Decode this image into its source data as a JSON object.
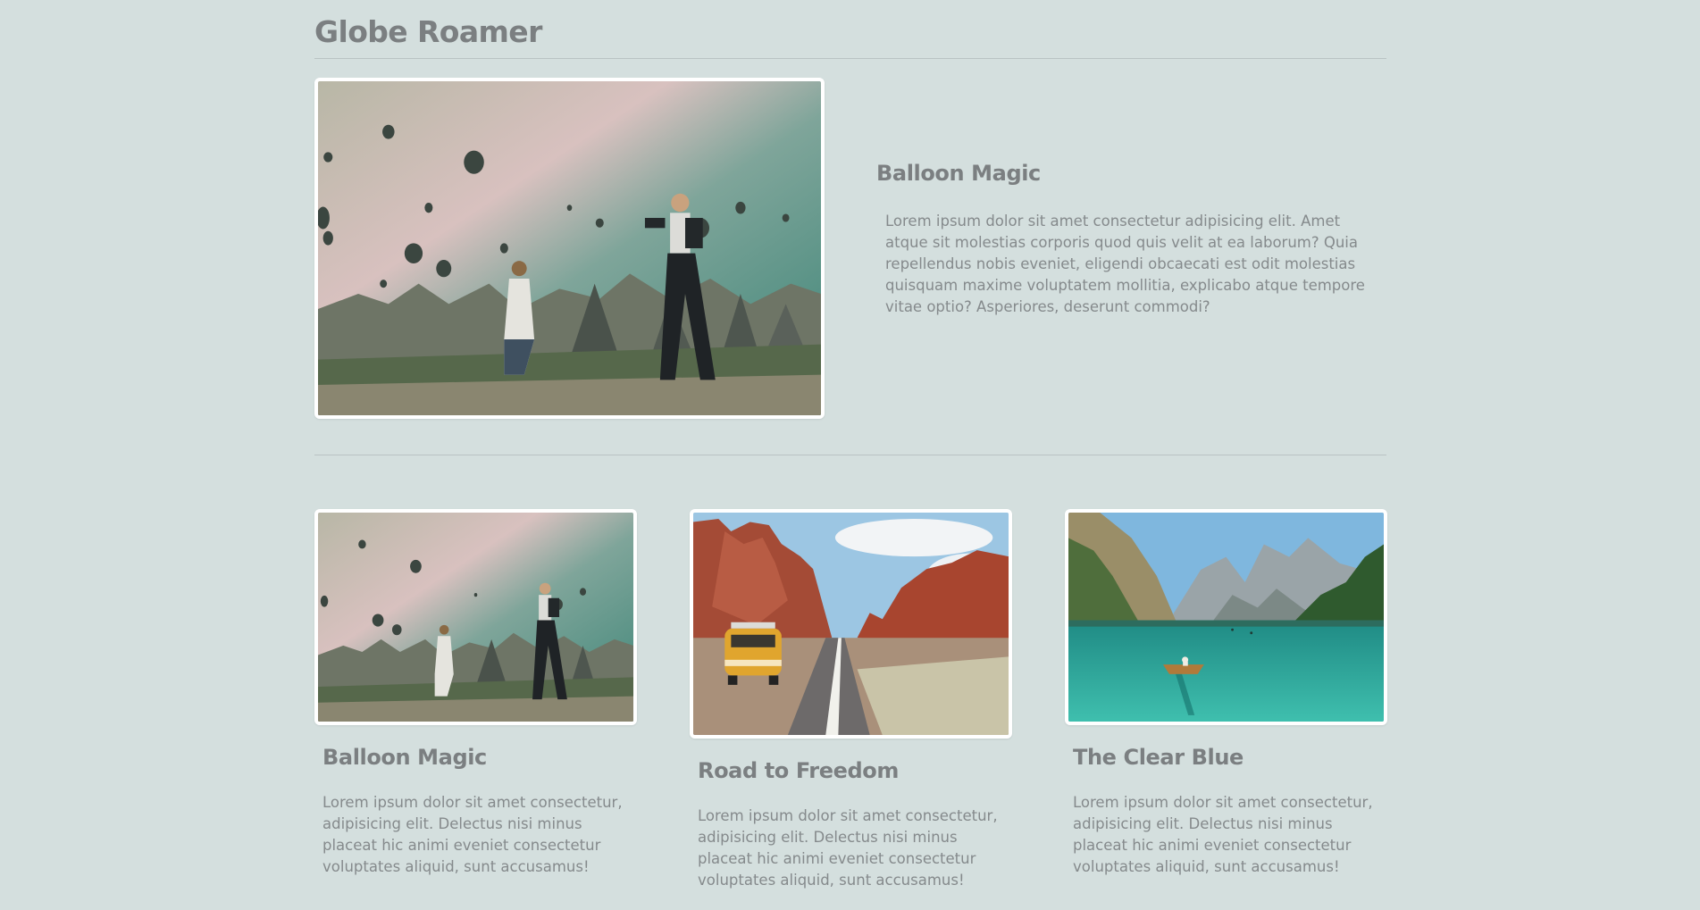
{
  "site": {
    "title": "Globe Roamer"
  },
  "featured": {
    "heading": "Balloon Magic",
    "text": "Lorem ipsum dolor sit amet consectetur adipisicing elit. Amet atque sit molestias corporis quod quis velit at ea laborum? Quia repellendus nobis eveniet, eligendi obcaecati est odit molestias quisquam maxime voluptatem mollitia, explicabo atque tempore vitae optio? Asperiores, deserunt commodi?"
  },
  "cards": [
    {
      "heading": "Balloon Magic",
      "text": "Lorem ipsum dolor sit amet consectetur, adipisicing elit. Delectus nisi minus placeat hic animi eveniet consectetur voluptates aliquid, sunt accusamus!"
    },
    {
      "heading": "Road to Freedom",
      "text": "Lorem ipsum dolor sit amet consectetur, adipisicing elit. Delectus nisi minus placeat hic animi eveniet consectetur voluptates aliquid, sunt accusamus!"
    },
    {
      "heading": "The Clear Blue",
      "text": "Lorem ipsum dolor sit amet consectetur, adipisicing elit. Delectus nisi minus placeat hic animi eveniet consectetur voluptates aliquid, sunt accusamus!"
    }
  ],
  "colors": {
    "background": "#d4dfde",
    "heading": "#7b7f81",
    "body_text": "#858a8c",
    "divider": "#b9c3c3",
    "photo_border": "#ffffff"
  }
}
